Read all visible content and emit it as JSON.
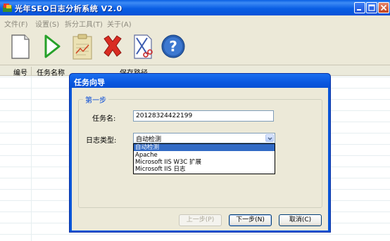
{
  "window": {
    "title": "光年SEO日志分析系统 V2.0"
  },
  "menu": [
    {
      "label": "文件(F)"
    },
    {
      "label": "设置(S)"
    },
    {
      "label": "拆分工具(T)"
    },
    {
      "label": "关于(A)"
    }
  ],
  "toolbar": [
    {
      "icon": "new-document-icon"
    },
    {
      "icon": "play-icon"
    },
    {
      "icon": "report-icon"
    },
    {
      "icon": "delete-icon"
    },
    {
      "icon": "split-tool-icon"
    },
    {
      "icon": "help-icon"
    }
  ],
  "table": {
    "columns": [
      "编号",
      "任务名称",
      "保存路径"
    ]
  },
  "dialog": {
    "title": "任务向导",
    "group_label": "第一步",
    "task_name_label": "任务名:",
    "task_name_value": "20128324422199",
    "log_type_label": "日志类型:",
    "log_type_value": "自动检测",
    "log_type_options": [
      "自动检测",
      "Apache",
      "Microsoft IIS W3C 扩展",
      "Microsoft IIS 日志"
    ],
    "buttons": {
      "prev": "上一步(P)",
      "next": "下一步(N)",
      "cancel": "取消(C)"
    }
  },
  "colors": {
    "title_bar": "#0a5fe3",
    "selection": "#316ac5",
    "window_face": "#ece9d8"
  }
}
